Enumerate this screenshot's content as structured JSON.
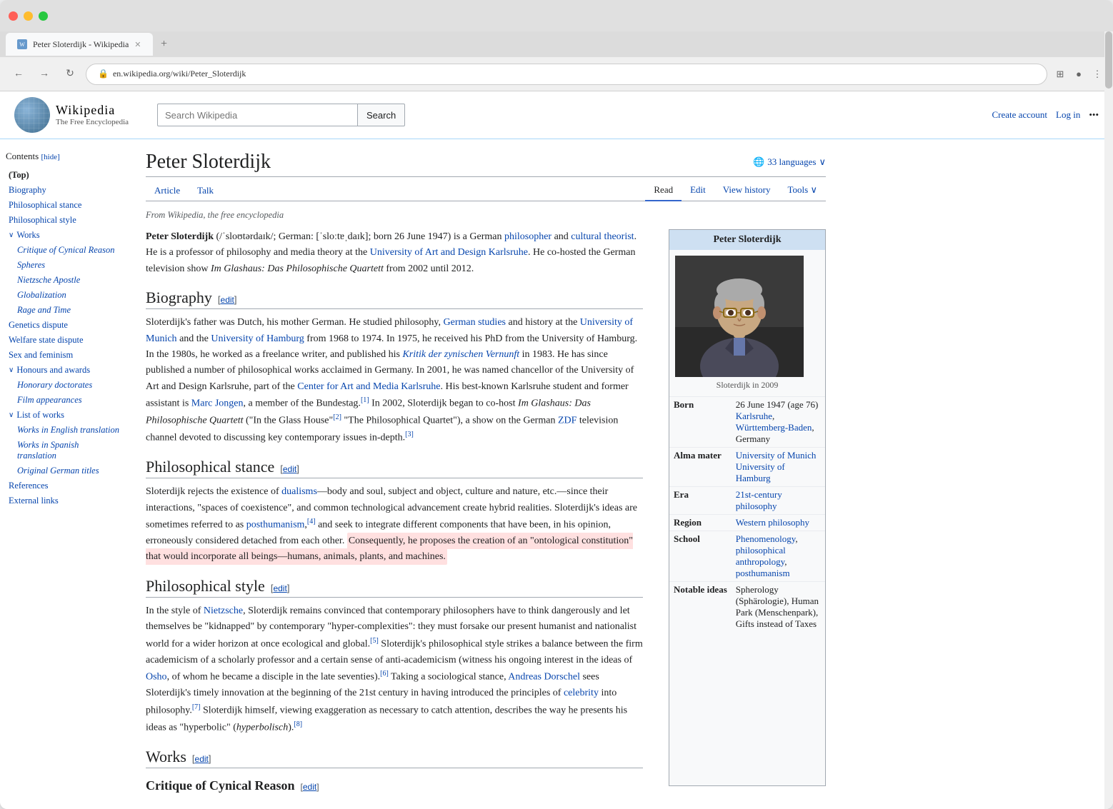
{
  "browser": {
    "tab_title": "Peter Sloterdijk - Wikipedia",
    "tab_favicon": "W",
    "new_tab_label": "+",
    "address": "en.wikipedia.org/wiki/Peter_Sloterdijk",
    "traffic_lights": [
      "red",
      "yellow",
      "green"
    ]
  },
  "wikipedia": {
    "logo_title": "Wikipedia",
    "logo_subtitle": "The Free Encyclopedia",
    "search_placeholder": "Search Wikipedia",
    "search_button": "Search",
    "header_links": {
      "create_account": "Create account",
      "log_in": "Log in",
      "more": "•••"
    }
  },
  "article": {
    "title": "Peter Sloterdijk",
    "languages_btn": "33 languages",
    "from_text": "From Wikipedia, the free encyclopedia",
    "tabs": {
      "article": "Article",
      "talk": "Talk",
      "read": "Read",
      "edit": "Edit",
      "view_history": "View history",
      "tools": "Tools"
    },
    "intro": "Peter Sloterdijk (/ˈsloʊtərdaɪk/; German: [ˈsloːtɐˌdaɪk]; born 26 June 1947) is a German philosopher and cultural theorist. He is a professor of philosophy and media theory at the University of Art and Design Karlsruhe. He co-hosted the German television show Im Glashaus: Das Philosophische Quartett from 2002 until 2012.",
    "sections": {
      "biography": {
        "heading": "Biography",
        "edit_label": "edit",
        "text": "Sloterdijk's father was Dutch, his mother German. He studied philosophy, German studies and history at the University of Munich and the University of Hamburg from 1968 to 1974. In 1975, he received his PhD from the University of Hamburg. In the 1980s, he worked as a freelance writer, and published his Kritik der zynischen Vernunft in 1983. He has since published a number of philosophical works acclaimed in Germany. In 2001, he was named chancellor of the University of Art and Design Karlsruhe, part of the Center for Art and Media Karlsruhe. His best-known Karlsruhe student and former assistant is Marc Jongen, a member of the Bundestag.[1] In 2002, Sloterdijk began to co-host Im Glashaus: Das Philosophische Quartett (\"In the Glass House\"[2] \"The Philosophical Quartet\"), a show on the German ZDF television channel devoted to discussing key contemporary issues in-depth.[3]"
      },
      "philosophical_stance": {
        "heading": "Philosophical stance",
        "edit_label": "edit",
        "text_before_highlight": "Sloterdijk rejects the existence of dualisms—body and soul, subject and object, culture and nature, etc.—since their interactions, \"spaces of coexistence\", and common technological advancement create hybrid realities. Sloterdijk's ideas are sometimes referred to as posthumanism,[4] and seek to integrate different components that have been, in his opinion, erroneously considered detached from each other.",
        "text_highlight": "Consequently, he proposes the creation of an \"ontological constitution\" that would incorporate all beings—humans, animals, plants, and machines.",
        "text_after_highlight": ""
      },
      "philosophical_style": {
        "heading": "Philosophical style",
        "edit_label": "edit",
        "text": "In the style of Nietzsche, Sloterdijk remains convinced that contemporary philosophers have to think dangerously and let themselves be \"kidnapped\" by contemporary \"hyper-complexities\": they must forsake our present humanist and nationalist world for a wider horizon at once ecological and global.[5] Sloterdijk's philosophical style strikes a balance between the firm academicism of a scholarly professor and a certain sense of anti-academicism (witness his ongoing interest in the ideas of Osho, of whom he became a disciple in the late seventies).[6] Taking a sociological stance, Andreas Dorschel sees Sloterdijk's timely innovation at the beginning of the 21st century in having introduced the principles of celebrity into philosophy.[7] Sloterdijk himself, viewing exaggeration as necessary to catch attention, describes the way he presents his ideas as \"hyperbolic\" (hyperbolisch).[8]"
      },
      "works": {
        "heading": "Works",
        "edit_label": "edit",
        "subheading": "Critique of Cynical Reason",
        "subedit": "edit"
      }
    },
    "infobox": {
      "title": "Peter Sloterdijk",
      "caption": "Sloterdijk in 2009",
      "born_label": "Born",
      "born_value": "26 June 1947 (age 76)",
      "born_place": "Karlsruhe, Württemberg-Baden, Germany",
      "alma_label": "Alma mater",
      "alma_value1": "University of Munich",
      "alma_value2": "University of Hamburg",
      "era_label": "Era",
      "era_value": "21st-century philosophy",
      "region_label": "Region",
      "region_value": "Western philosophy",
      "school_label": "School",
      "school_value": "Phenomenology, philosophical anthropology, posthumanism",
      "notable_label": "Notable ideas",
      "notable_value": "Spherology (Sphärologie), Human Park (Menschenpark), Gifts instead of Taxes"
    }
  },
  "toc": {
    "title": "Contents",
    "hide_label": "[hide]",
    "items": [
      {
        "id": "top",
        "label": "(Top)",
        "level": 0,
        "bold": true
      },
      {
        "id": "biography",
        "label": "Biography",
        "level": 0
      },
      {
        "id": "philosophical-stance",
        "label": "Philosophical stance",
        "level": 0
      },
      {
        "id": "philosophical-style",
        "label": "Philosophical style",
        "level": 0
      },
      {
        "id": "works",
        "label": "Works",
        "level": 0,
        "has-children": true
      },
      {
        "id": "critique",
        "label": "Critique of Cynical Reason",
        "level": 1,
        "italic": true
      },
      {
        "id": "spheres",
        "label": "Spheres",
        "level": 1,
        "italic": true
      },
      {
        "id": "nietzsche",
        "label": "Nietzsche Apostle",
        "level": 1,
        "italic": true
      },
      {
        "id": "globalization",
        "label": "Globalization",
        "level": 1,
        "italic": true
      },
      {
        "id": "rage-time",
        "label": "Rage and Time",
        "level": 1,
        "italic": true
      },
      {
        "id": "genetics",
        "label": "Genetics dispute",
        "level": 0
      },
      {
        "id": "welfare",
        "label": "Welfare state dispute",
        "level": 0
      },
      {
        "id": "sex",
        "label": "Sex and feminism",
        "level": 0
      },
      {
        "id": "honours",
        "label": "Honours and awards",
        "level": 0,
        "has-children": true
      },
      {
        "id": "honorary",
        "label": "Honorary doctorates",
        "level": 1
      },
      {
        "id": "film",
        "label": "Film appearances",
        "level": 1
      },
      {
        "id": "list-works",
        "label": "List of works",
        "level": 0,
        "has-children": true
      },
      {
        "id": "english",
        "label": "Works in English translation",
        "level": 1
      },
      {
        "id": "spanish",
        "label": "Works in Spanish translation",
        "level": 1
      },
      {
        "id": "german",
        "label": "Original German titles",
        "level": 1
      },
      {
        "id": "references",
        "label": "References",
        "level": 0
      },
      {
        "id": "external",
        "label": "External links",
        "level": 0
      }
    ]
  }
}
